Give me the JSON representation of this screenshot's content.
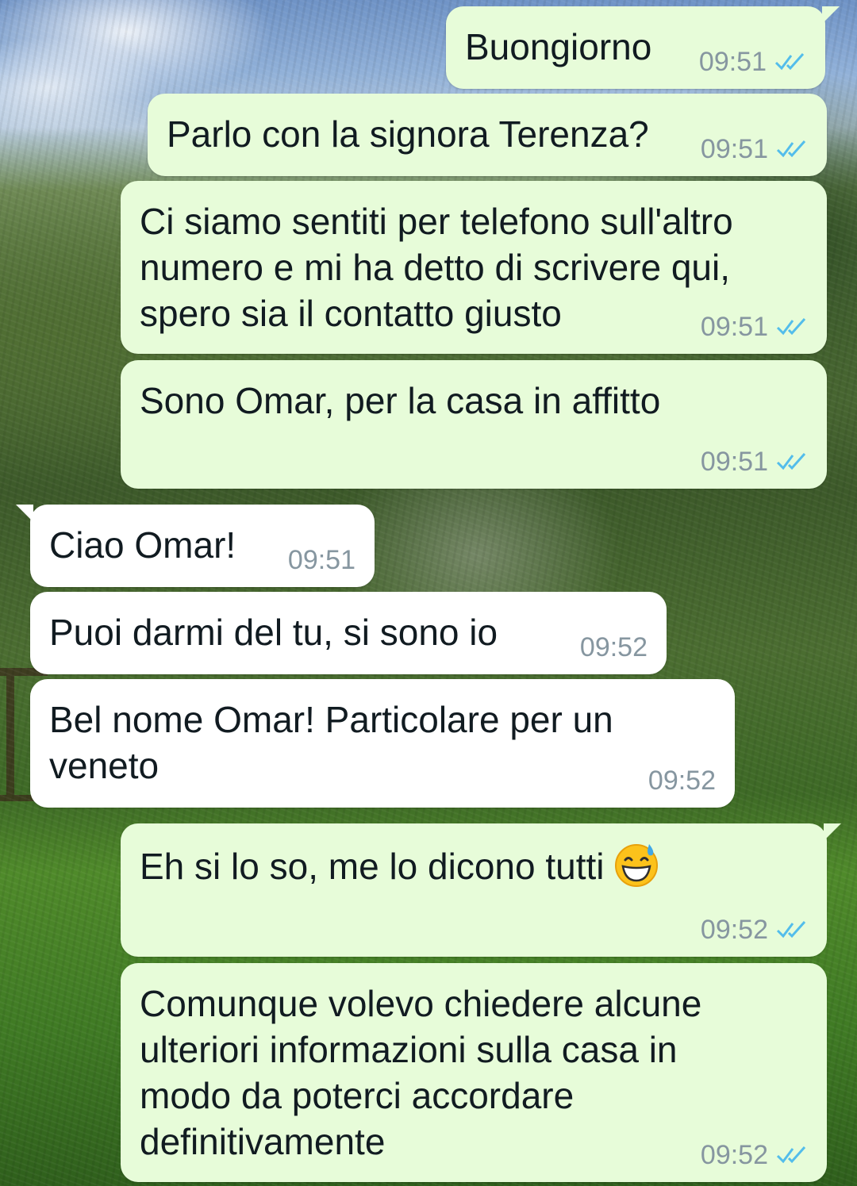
{
  "messages": [
    {
      "direction": "out",
      "text": "Buongiorno",
      "time": "09:51",
      "status_icon": "double-check-read-icon"
    },
    {
      "direction": "out",
      "text": "Parlo con la signora Terenza?",
      "time": "09:51",
      "status_icon": "double-check-read-icon"
    },
    {
      "direction": "out",
      "text": "Ci siamo sentiti per telefono sull'altro numero e mi ha detto di scrivere qui, spero sia il contatto giusto",
      "time": "09:51",
      "status_icon": "double-check-read-icon"
    },
    {
      "direction": "out",
      "text": "Sono Omar, per la casa in affitto",
      "time": "09:51",
      "status_icon": "double-check-read-icon"
    },
    {
      "direction": "in",
      "text": "Ciao Omar!",
      "time": "09:51"
    },
    {
      "direction": "in",
      "text": "Puoi darmi del tu, si sono io",
      "time": "09:52"
    },
    {
      "direction": "in",
      "text": "Bel nome Omar! Particolare per un veneto",
      "time": "09:52"
    },
    {
      "direction": "out",
      "text": "Eh si lo so, me lo dicono tutti",
      "emoji": "grinning-face-with-sweat-emoji",
      "time": "09:52",
      "status_icon": "double-check-read-icon"
    },
    {
      "direction": "out",
      "text": "Comunque volevo chiedere alcune ulteriori informazioni sulla casa in modo da poterci accordare definitivamente",
      "time": "09:52",
      "status_icon": "double-check-read-icon"
    }
  ],
  "colors": {
    "outgoing_bubble": "#e7fcd9",
    "incoming_bubble": "#ffffff",
    "timestamp": "#8696a0",
    "read_ticks": "#53bdeb"
  }
}
